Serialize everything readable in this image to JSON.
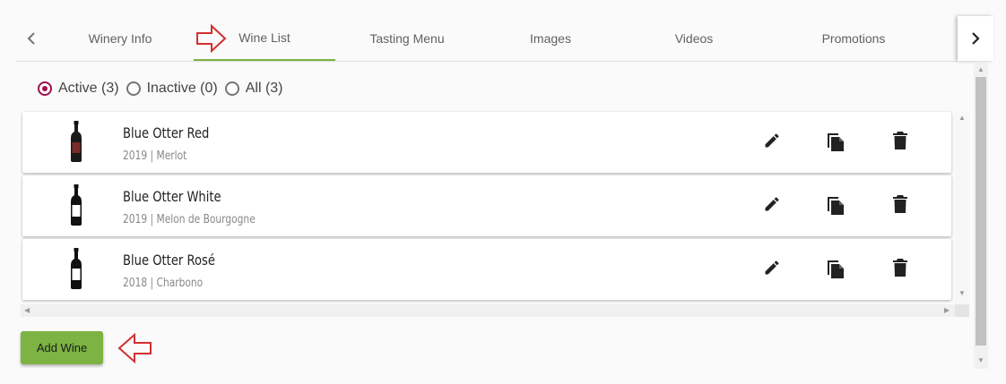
{
  "tabs": [
    {
      "label": "Winery Info",
      "active": false
    },
    {
      "label": "Wine List",
      "active": true
    },
    {
      "label": "Tasting Menu",
      "active": false
    },
    {
      "label": "Images",
      "active": false
    },
    {
      "label": "Videos",
      "active": false
    },
    {
      "label": "Promotions",
      "active": false
    }
  ],
  "filters": {
    "active": "Active (3)",
    "inactive": "Inactive (0)",
    "all": "All (3)",
    "selected": "active"
  },
  "wines": [
    {
      "name": "Blue Otter Red",
      "details": "2019 | Merlot",
      "bottle": "red"
    },
    {
      "name": "Blue Otter White",
      "details": "2019 | Melon de Bourgogne",
      "bottle": "white"
    },
    {
      "name": "Blue Otter Rosé",
      "details": "2018 | Charbono",
      "bottle": "white"
    }
  ],
  "actions": {
    "add_wine_label": "Add Wine"
  },
  "icons": {
    "prev": "chevron-left-icon",
    "next": "chevron-right-icon",
    "edit": "pencil-icon",
    "duplicate": "copy-icon",
    "delete": "trash-icon"
  },
  "colors": {
    "accent": "#7cb342",
    "radio": "#a0104e",
    "annotation": "#d32f2f"
  }
}
